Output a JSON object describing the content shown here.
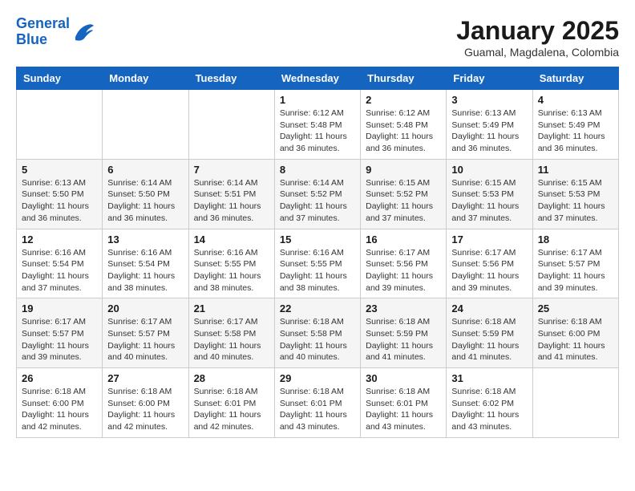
{
  "header": {
    "logo_line1": "General",
    "logo_line2": "Blue",
    "month_title": "January 2025",
    "location": "Guamal, Magdalena, Colombia"
  },
  "days_of_week": [
    "Sunday",
    "Monday",
    "Tuesday",
    "Wednesday",
    "Thursday",
    "Friday",
    "Saturday"
  ],
  "weeks": [
    [
      {
        "day": "",
        "info": ""
      },
      {
        "day": "",
        "info": ""
      },
      {
        "day": "",
        "info": ""
      },
      {
        "day": "1",
        "info": "Sunrise: 6:12 AM\nSunset: 5:48 PM\nDaylight: 11 hours\nand 36 minutes."
      },
      {
        "day": "2",
        "info": "Sunrise: 6:12 AM\nSunset: 5:48 PM\nDaylight: 11 hours\nand 36 minutes."
      },
      {
        "day": "3",
        "info": "Sunrise: 6:13 AM\nSunset: 5:49 PM\nDaylight: 11 hours\nand 36 minutes."
      },
      {
        "day": "4",
        "info": "Sunrise: 6:13 AM\nSunset: 5:49 PM\nDaylight: 11 hours\nand 36 minutes."
      }
    ],
    [
      {
        "day": "5",
        "info": "Sunrise: 6:13 AM\nSunset: 5:50 PM\nDaylight: 11 hours\nand 36 minutes."
      },
      {
        "day": "6",
        "info": "Sunrise: 6:14 AM\nSunset: 5:50 PM\nDaylight: 11 hours\nand 36 minutes."
      },
      {
        "day": "7",
        "info": "Sunrise: 6:14 AM\nSunset: 5:51 PM\nDaylight: 11 hours\nand 36 minutes."
      },
      {
        "day": "8",
        "info": "Sunrise: 6:14 AM\nSunset: 5:52 PM\nDaylight: 11 hours\nand 37 minutes."
      },
      {
        "day": "9",
        "info": "Sunrise: 6:15 AM\nSunset: 5:52 PM\nDaylight: 11 hours\nand 37 minutes."
      },
      {
        "day": "10",
        "info": "Sunrise: 6:15 AM\nSunset: 5:53 PM\nDaylight: 11 hours\nand 37 minutes."
      },
      {
        "day": "11",
        "info": "Sunrise: 6:15 AM\nSunset: 5:53 PM\nDaylight: 11 hours\nand 37 minutes."
      }
    ],
    [
      {
        "day": "12",
        "info": "Sunrise: 6:16 AM\nSunset: 5:54 PM\nDaylight: 11 hours\nand 37 minutes."
      },
      {
        "day": "13",
        "info": "Sunrise: 6:16 AM\nSunset: 5:54 PM\nDaylight: 11 hours\nand 38 minutes."
      },
      {
        "day": "14",
        "info": "Sunrise: 6:16 AM\nSunset: 5:55 PM\nDaylight: 11 hours\nand 38 minutes."
      },
      {
        "day": "15",
        "info": "Sunrise: 6:16 AM\nSunset: 5:55 PM\nDaylight: 11 hours\nand 38 minutes."
      },
      {
        "day": "16",
        "info": "Sunrise: 6:17 AM\nSunset: 5:56 PM\nDaylight: 11 hours\nand 39 minutes."
      },
      {
        "day": "17",
        "info": "Sunrise: 6:17 AM\nSunset: 5:56 PM\nDaylight: 11 hours\nand 39 minutes."
      },
      {
        "day": "18",
        "info": "Sunrise: 6:17 AM\nSunset: 5:57 PM\nDaylight: 11 hours\nand 39 minutes."
      }
    ],
    [
      {
        "day": "19",
        "info": "Sunrise: 6:17 AM\nSunset: 5:57 PM\nDaylight: 11 hours\nand 39 minutes."
      },
      {
        "day": "20",
        "info": "Sunrise: 6:17 AM\nSunset: 5:57 PM\nDaylight: 11 hours\nand 40 minutes."
      },
      {
        "day": "21",
        "info": "Sunrise: 6:17 AM\nSunset: 5:58 PM\nDaylight: 11 hours\nand 40 minutes."
      },
      {
        "day": "22",
        "info": "Sunrise: 6:18 AM\nSunset: 5:58 PM\nDaylight: 11 hours\nand 40 minutes."
      },
      {
        "day": "23",
        "info": "Sunrise: 6:18 AM\nSunset: 5:59 PM\nDaylight: 11 hours\nand 41 minutes."
      },
      {
        "day": "24",
        "info": "Sunrise: 6:18 AM\nSunset: 5:59 PM\nDaylight: 11 hours\nand 41 minutes."
      },
      {
        "day": "25",
        "info": "Sunrise: 6:18 AM\nSunset: 6:00 PM\nDaylight: 11 hours\nand 41 minutes."
      }
    ],
    [
      {
        "day": "26",
        "info": "Sunrise: 6:18 AM\nSunset: 6:00 PM\nDaylight: 11 hours\nand 42 minutes."
      },
      {
        "day": "27",
        "info": "Sunrise: 6:18 AM\nSunset: 6:00 PM\nDaylight: 11 hours\nand 42 minutes."
      },
      {
        "day": "28",
        "info": "Sunrise: 6:18 AM\nSunset: 6:01 PM\nDaylight: 11 hours\nand 42 minutes."
      },
      {
        "day": "29",
        "info": "Sunrise: 6:18 AM\nSunset: 6:01 PM\nDaylight: 11 hours\nand 43 minutes."
      },
      {
        "day": "30",
        "info": "Sunrise: 6:18 AM\nSunset: 6:01 PM\nDaylight: 11 hours\nand 43 minutes."
      },
      {
        "day": "31",
        "info": "Sunrise: 6:18 AM\nSunset: 6:02 PM\nDaylight: 11 hours\nand 43 minutes."
      },
      {
        "day": "",
        "info": ""
      }
    ]
  ]
}
